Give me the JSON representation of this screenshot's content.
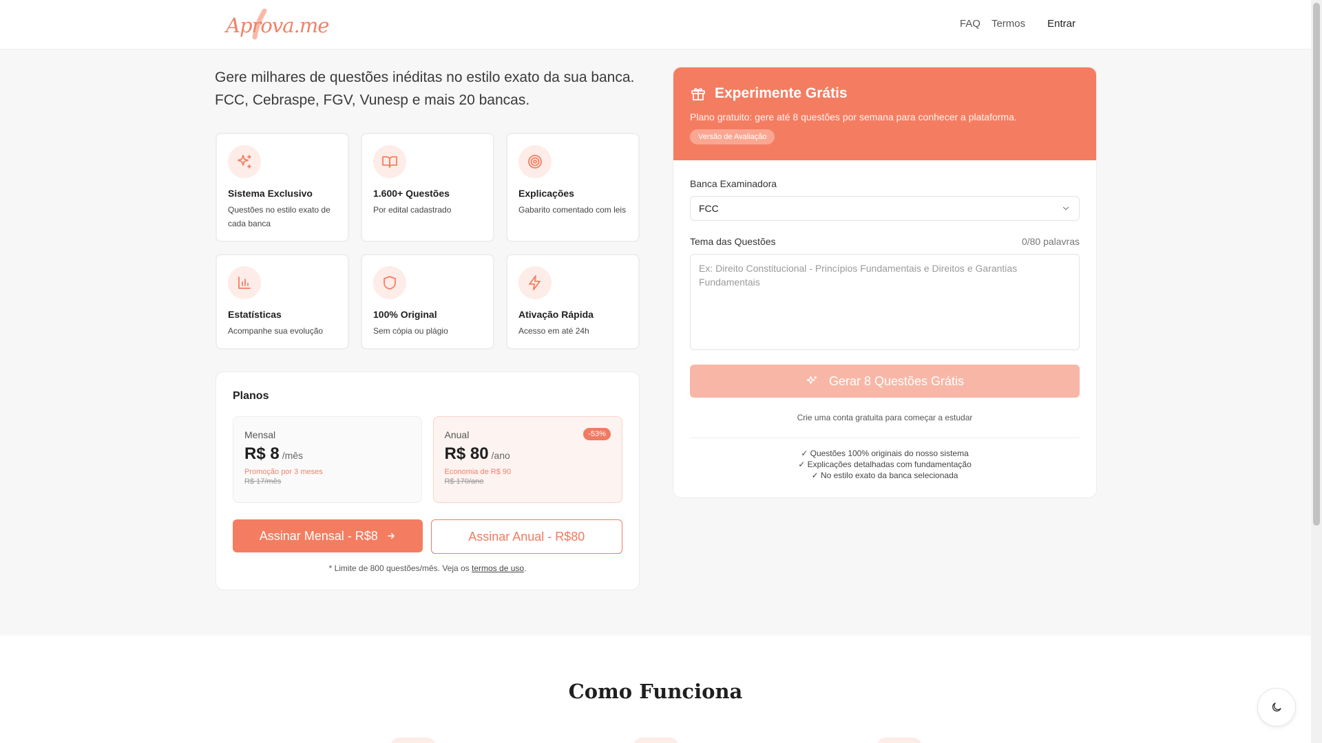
{
  "header": {
    "logo_text": "Aprova.me",
    "nav": {
      "faq": "FAQ",
      "terms": "Termos",
      "login": "Entrar"
    }
  },
  "hero": {
    "line1": "Gere milhares de questões inéditas no estilo exato da sua banca.",
    "line2": "FCC, Cebraspe, FGV, Vunesp e mais 20 bancas."
  },
  "features": [
    {
      "icon": "sparkles-icon",
      "title": "Sistema Exclusivo",
      "desc": "Questões no estilo exato de cada banca"
    },
    {
      "icon": "book-open-icon",
      "title": "1.600+ Questões",
      "desc": "Por edital cadastrado"
    },
    {
      "icon": "target-icon",
      "title": "Explicações",
      "desc": "Gabarito comentado com leis"
    },
    {
      "icon": "bar-chart-icon",
      "title": "Estatísticas",
      "desc": "Acompanhe sua evolução"
    },
    {
      "icon": "shield-icon",
      "title": "100% Original",
      "desc": "Sem cópia ou plágio"
    },
    {
      "icon": "zap-icon",
      "title": "Ativação Rápida",
      "desc": "Acesso em até 24h"
    }
  ],
  "plans": {
    "title": "Planos",
    "monthly": {
      "name": "Mensal",
      "amount": "R$ 8",
      "per": "/mês",
      "promo": "Promoção por 3 meses",
      "old": "R$ 17/mês"
    },
    "annual": {
      "name": "Anual",
      "badge": "-53%",
      "amount": "R$ 80",
      "per": "/ano",
      "promo": "Economia de R$ 90",
      "old": "R$ 170/ano"
    },
    "btn_monthly": "Assinar Mensal - R$8",
    "btn_annual": "Assinar Anual - R$80",
    "note_prefix": "* Limite de 800 questões/mês. Veja os ",
    "note_link": "termos de uso",
    "note_suffix": "."
  },
  "trial": {
    "title": "Experimente Grátis",
    "subtitle": "Plano gratuito: gere até 8 questões por semana para conhecer a plataforma.",
    "tag": "Versão de Avaliação",
    "banca_label": "Banca Examinadora",
    "banca_value": "FCC",
    "tema_label": "Tema das Questões",
    "word_count": "0/80 palavras",
    "tema_placeholder": "Ex: Direito Constitucional - Princípios Fundamentais e Direitos e Garantias Fundamentais",
    "generate_btn": "Gerar 8 Questões Grátis",
    "account_note": "Crie uma conta gratuita para começar a estudar",
    "checks": [
      "✓ Questões 100% originais do nosso sistema",
      "✓ Explicações detalhadas com fundamentação",
      "✓ No estilo exato da banca selecionada"
    ]
  },
  "how": {
    "title": "Como Funciona"
  },
  "colors": {
    "accent": "#f47d61",
    "accent_light": "#fdece7",
    "accent_disabled": "#f8b7a6"
  }
}
